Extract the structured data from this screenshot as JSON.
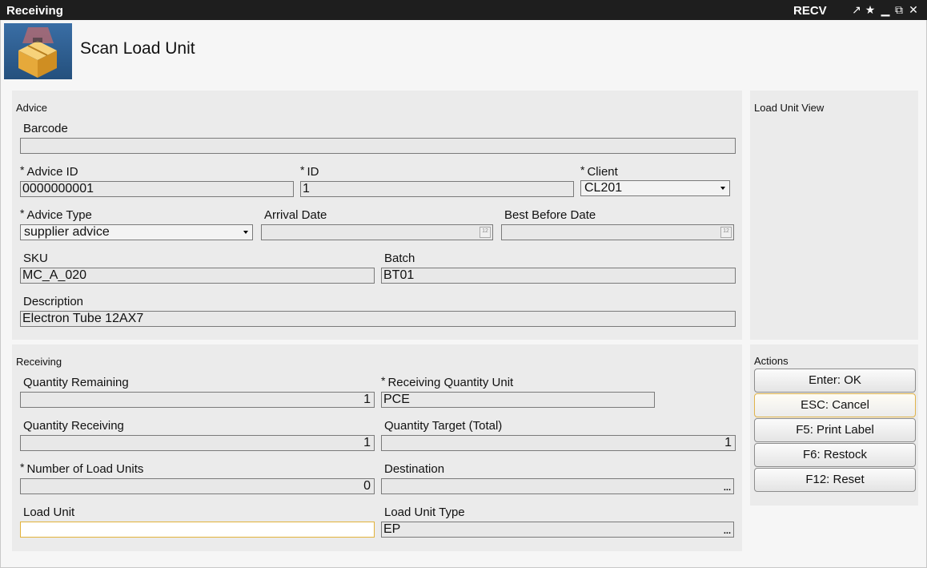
{
  "titlebar": {
    "title": "Receiving",
    "code": "RECV"
  },
  "page": {
    "title": "Scan Load Unit"
  },
  "advice_panel": {
    "title": "Advice",
    "barcode_label": "Barcode",
    "barcode_value": "",
    "advice_id_label": "Advice ID",
    "advice_id_value": "0000000001",
    "id_label": "ID",
    "id_value": "1",
    "client_label": "Client",
    "client_value": "CL201",
    "advice_type_label": "Advice Type",
    "advice_type_value": "supplier advice",
    "arrival_date_label": "Arrival Date",
    "arrival_date_value": "",
    "best_before_label": "Best Before Date",
    "best_before_value": "",
    "sku_label": "SKU",
    "sku_value": "MC_A_020",
    "batch_label": "Batch",
    "batch_value": "BT01",
    "description_label": "Description",
    "description_value": "Electron Tube 12AX7"
  },
  "receiving_panel": {
    "title": "Receiving",
    "qty_remaining_label": "Quantity Remaining",
    "qty_remaining_value": "1",
    "recv_qty_unit_label": "Receiving Quantity Unit",
    "recv_qty_unit_value": "PCE",
    "qty_receiving_label": "Quantity Receiving",
    "qty_receiving_value": "1",
    "qty_target_label": "Quantity Target (Total)",
    "qty_target_value": "1",
    "num_load_units_label": "Number of Load Units",
    "num_load_units_value": "0",
    "destination_label": "Destination",
    "destination_value": "",
    "load_unit_label": "Load Unit",
    "load_unit_value": "",
    "load_unit_type_label": "Load Unit Type",
    "load_unit_type_value": "EP"
  },
  "load_unit_view": {
    "title": "Load Unit View"
  },
  "actions": {
    "title": "Actions",
    "ok": "Enter: OK",
    "cancel": "ESC: Cancel",
    "print_label": "F5: Print Label",
    "restock": "F6: Restock",
    "reset": "F12: Reset"
  },
  "required_marker": "*",
  "icons": [
    "pin-icon",
    "star-icon",
    "minimize-icon",
    "restore-icon",
    "close-icon",
    "package-icon",
    "calendar-icon",
    "ellipsis-icon",
    "dropdown-caret-icon"
  ],
  "colors": {
    "titlebar": "#1e1e1e",
    "panel": "#ebebeb",
    "field": "#e8e8e8",
    "focus_border": "#e2b23a",
    "icon_bg": "#3a6ea5"
  }
}
